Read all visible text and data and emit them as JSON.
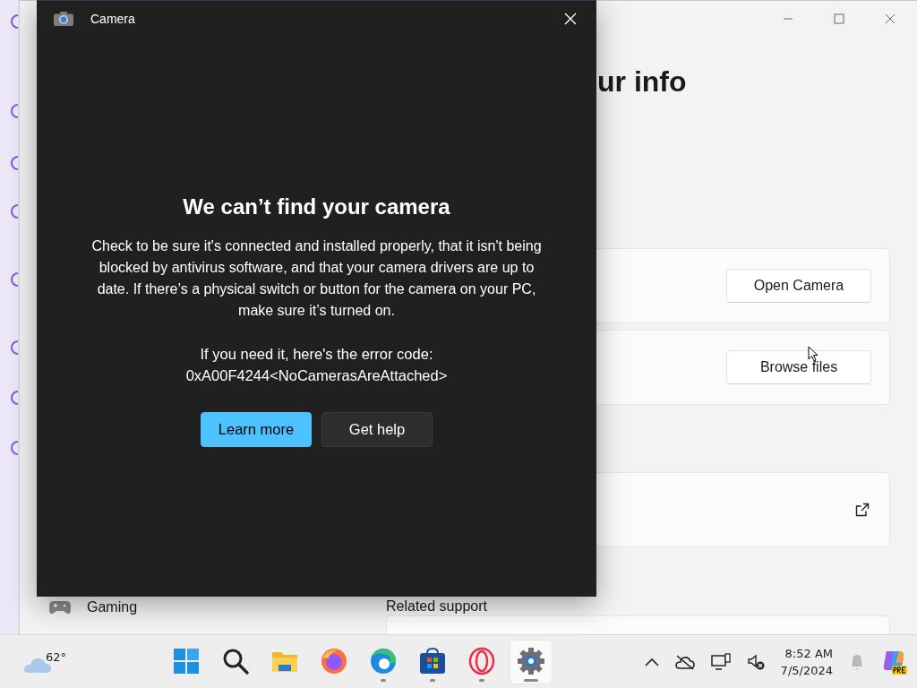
{
  "settings_window": {
    "heading": "ur info",
    "cards": [
      {
        "kind": "button",
        "label": "Open Camera"
      },
      {
        "kind": "button",
        "label": "Browse files"
      },
      {
        "kind": "link"
      },
      {
        "kind": "blank"
      }
    ],
    "section_title": "Related support",
    "nav_items": [
      {
        "label": "Gaming"
      }
    ]
  },
  "camera_window": {
    "title": "Camera",
    "heading": "We can’t find your camera",
    "message": "Check to be sure it's connected and installed properly, that it isn't being blocked by antivirus software, and that your camera drivers are up to date. If there’s a physical switch or button for the camera on your PC, make sure it’s turned on.",
    "error_label": "If you need it, here's the error code:",
    "error_code": "0xA00F4244<NoCamerasAreAttached>",
    "buttons": [
      {
        "label": "Learn more",
        "kind": "primary"
      },
      {
        "label": "Get help",
        "kind": "secondary"
      }
    ]
  },
  "taskbar": {
    "temperature": "62°",
    "apps": [
      {
        "kind": "start",
        "running": false,
        "active": false
      },
      {
        "kind": "search",
        "running": false,
        "active": false
      },
      {
        "kind": "files",
        "running": false,
        "active": false
      },
      {
        "kind": "firefox",
        "running": false,
        "active": false
      },
      {
        "kind": "edge",
        "running": true,
        "active": false
      },
      {
        "kind": "store",
        "running": true,
        "active": false
      },
      {
        "kind": "opera",
        "running": true,
        "active": false
      },
      {
        "kind": "settings",
        "running": true,
        "active": true
      }
    ],
    "time": "8:52 AM",
    "date": "7/5/2024"
  }
}
